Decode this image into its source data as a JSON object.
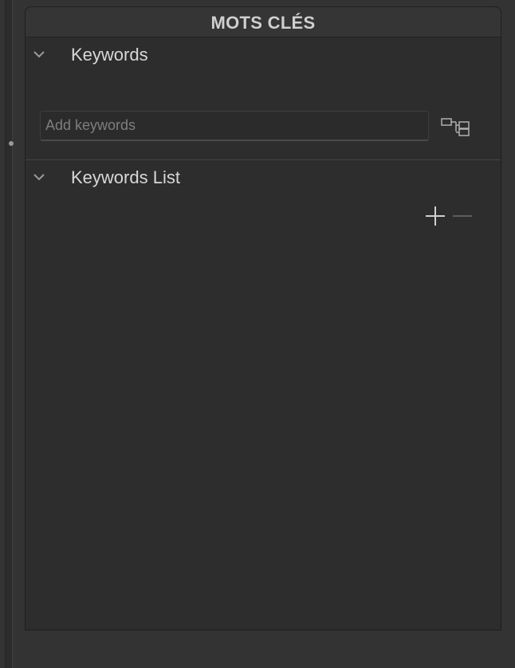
{
  "panel": {
    "title": "MOTS CLÉS"
  },
  "keywords_section": {
    "title": "Keywords",
    "expanded": true,
    "input": {
      "value": "",
      "placeholder": "Add keywords"
    },
    "hierarchy_button_icon": "hierarchy-tree-icon"
  },
  "keywords_list_section": {
    "title": "Keywords List",
    "expanded": true,
    "add_icon": "plus-icon",
    "remove_icon": "minus-icon",
    "items": []
  },
  "colors": {
    "background": "#333333",
    "panel": "#2d2d2d",
    "header": "#353535",
    "text": "#d8d8d8",
    "placeholder": "#7e7e7e"
  }
}
